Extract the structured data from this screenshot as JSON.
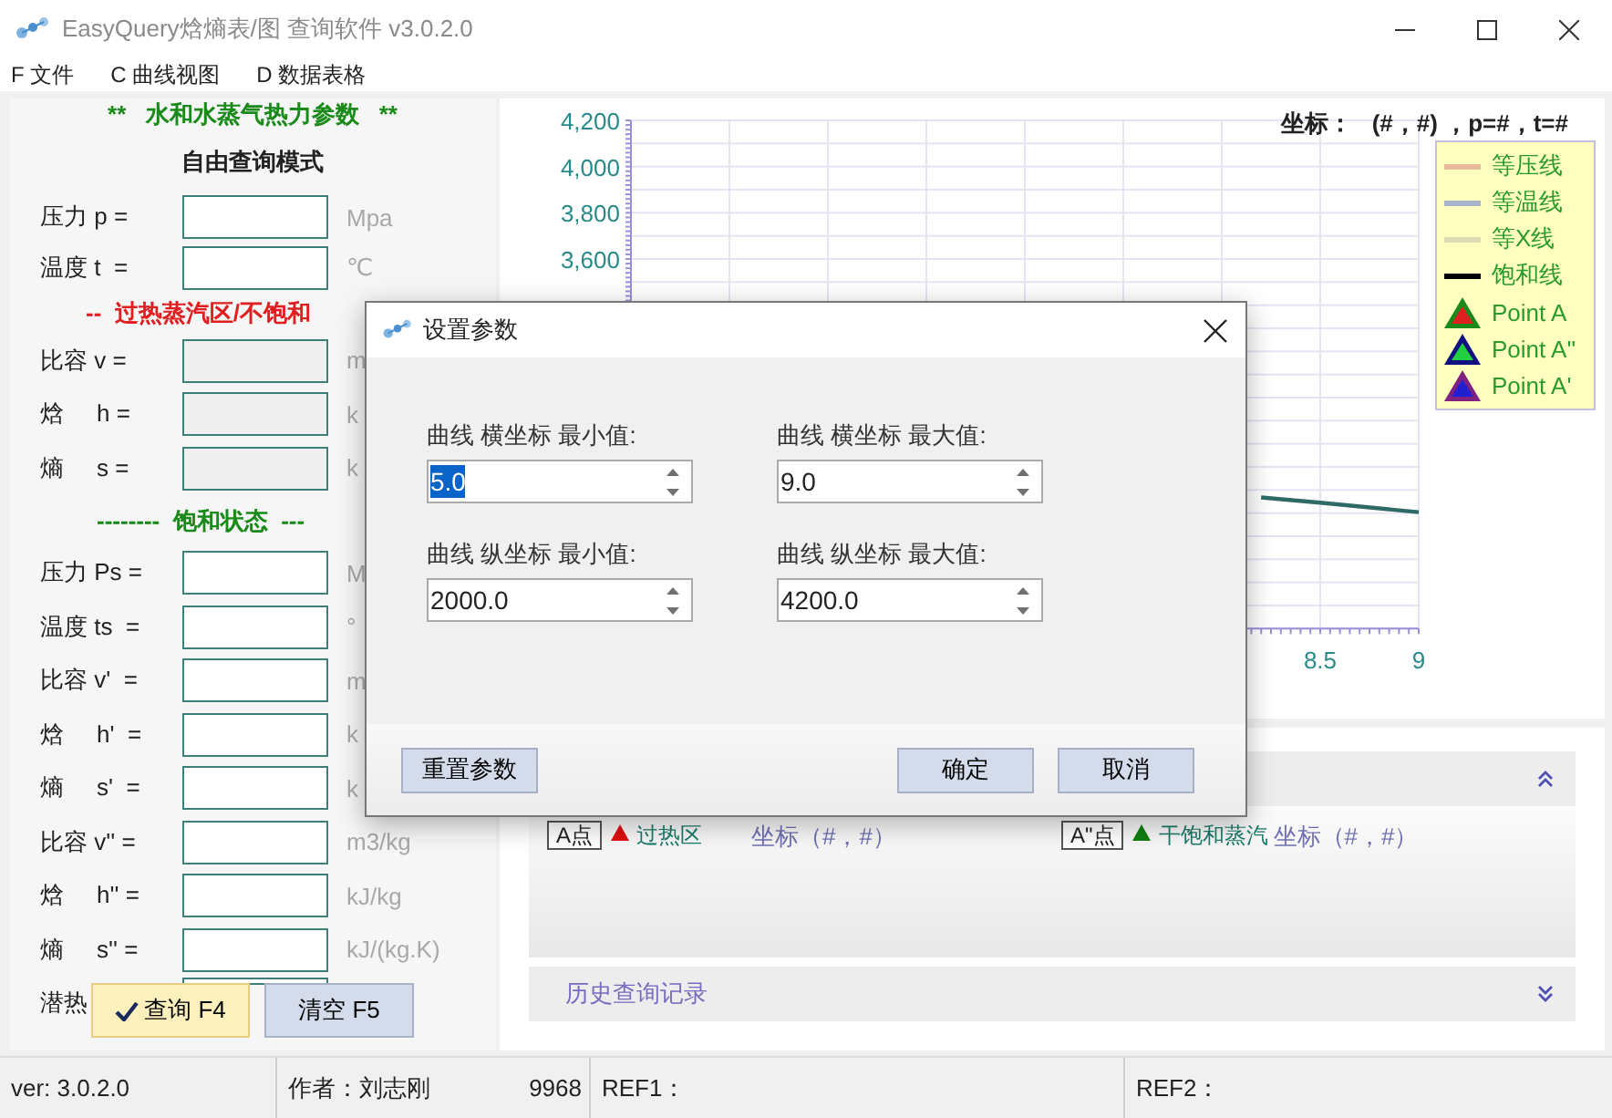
{
  "window": {
    "title": "EasyQuery焓熵表/图 查询软件 v3.0.2.0"
  },
  "menu": [
    {
      "label": "F 文件"
    },
    {
      "label": "C  曲线视图"
    },
    {
      "label": "D  数据表格"
    }
  ],
  "params_panel": {
    "heading": "**   水和水蒸气热力参数   **",
    "mode": "自由查询模式",
    "groups": [
      {
        "rows": [
          {
            "label": "压力 p =",
            "unit": "Mpa",
            "disabled": false
          },
          {
            "label": "温度 t  =",
            "unit": "℃",
            "disabled": false
          }
        ]
      },
      {
        "title": "--  过热蒸汽区/不饱和",
        "color": "#e02020",
        "rows": [
          {
            "label": "比容 v =",
            "unit": "m",
            "disabled": true
          },
          {
            "label": "焓     h =",
            "unit": "k",
            "disabled": true
          },
          {
            "label": "熵     s =",
            "unit": "k",
            "disabled": true
          }
        ]
      },
      {
        "title": "--------  饱和状态  ---",
        "color": "#1a8a1a",
        "rows": [
          {
            "label": "压力 Ps =",
            "unit": "M",
            "disabled": false
          },
          {
            "label": "温度 ts  =",
            "unit": "°",
            "disabled": false
          },
          {
            "label": "比容 v'  =",
            "unit": "m",
            "disabled": false
          },
          {
            "label": "焓     h'  =",
            "unit": "k",
            "disabled": false
          },
          {
            "label": "熵     s'  =",
            "unit": "k",
            "disabled": false
          },
          {
            "label": "比容 v'' =",
            "unit": "m3/kg",
            "disabled": false
          },
          {
            "label": "焓     h'' =",
            "unit": "kJ/kg",
            "disabled": false
          },
          {
            "label": "熵     s'' =",
            "unit": "kJ/(kg.K)",
            "disabled": false
          },
          {
            "label": "潜热",
            "unit": "",
            "disabled": false
          }
        ]
      }
    ],
    "buttons": [
      {
        "label": "查询 F4",
        "kind": "primary"
      },
      {
        "label": "清空 F5",
        "kind": "secondary"
      }
    ]
  },
  "chart": {
    "coords_label": "坐标：   (#，#) ，p=#，t=#",
    "chart_data": {
      "type": "line",
      "grid": true,
      "x": [
        8.2,
        8.5,
        9
      ],
      "xlim": [
        5,
        9
      ],
      "ylim": [
        2000,
        4200
      ],
      "xticks": [
        {
          "value": 8.5,
          "label": "8.5"
        },
        {
          "value": 9,
          "label": "9"
        }
      ],
      "yticks": [
        {
          "value": 3600,
          "label": "3,600"
        },
        {
          "value": 3800,
          "label": "3,800"
        },
        {
          "value": 4000,
          "label": "4,000"
        },
        {
          "value": 4200,
          "label": "4,200"
        }
      ],
      "series": [
        {
          "color": "#2f6b66",
          "values": [
            2568,
            2545,
            2504
          ]
        }
      ]
    },
    "legend": [
      {
        "label": "等压线",
        "kind": "line",
        "color": "#e8b898"
      },
      {
        "label": "等温线",
        "kind": "line",
        "color": "#a8b4cc"
      },
      {
        "label": "等X线",
        "kind": "line",
        "color": "#dcdcb4"
      },
      {
        "label": "饱和线",
        "kind": "line",
        "color": "#000000"
      },
      {
        "label": "Point A",
        "kind": "marker",
        "color": "#e02020",
        "outline": {
          "color": "#1a8a1a"
        }
      },
      {
        "label": "Point A''",
        "kind": "marker",
        "color": "#20d040",
        "outline": {
          "color": "#101080"
        }
      },
      {
        "label": "Point A'",
        "kind": "marker",
        "color": "#2020d0",
        "outline": {
          "color": "#802080"
        }
      }
    ]
  },
  "results": {
    "points": [
      {
        "tag": "A点",
        "region": "过热区",
        "color": "#e01010",
        "coords": "坐标（#，#）"
      },
      {
        "tag": "A\"点",
        "region": "干饱和蒸汽",
        "color": "#108010",
        "coords": "坐标（#，#）"
      }
    ],
    "history": {
      "label": "历史查询记录",
      "expanded": false
    }
  },
  "status_bar": {
    "version": "ver: 3.0.2.0",
    "author": "作者：刘志刚",
    "count": "9968",
    "ref1": "REF1：",
    "ref2": "REF2："
  },
  "dialog": {
    "title": "设置参数",
    "fields": [
      {
        "label": "曲线 横坐标 最小值:",
        "value": "5.0",
        "text_selected": true
      },
      {
        "label": "曲线 横坐标 最大值:",
        "value": "9.0",
        "text_selected": false
      },
      {
        "label": "曲线 纵坐标 最小值:",
        "value": "2000.0",
        "text_selected": false
      },
      {
        "label": "曲线 纵坐标 最大值:",
        "value": "4200.0",
        "text_selected": false
      }
    ],
    "buttons": [
      {
        "label": "重置参数"
      },
      {
        "label": "确定"
      },
      {
        "label": "取消"
      }
    ]
  }
}
